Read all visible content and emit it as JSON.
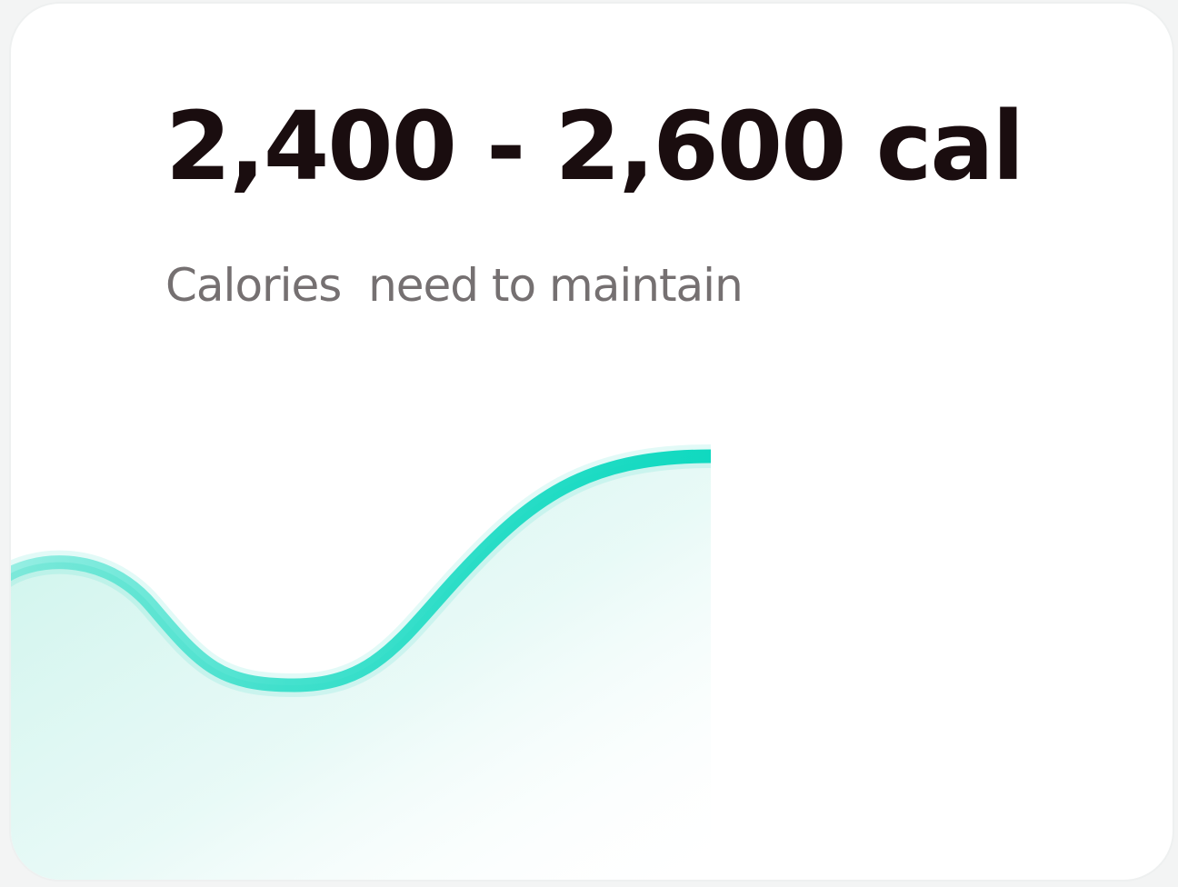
{
  "card": {
    "headline": "2,400 - 2,600 cal",
    "subtitle": "Calories  need to maintain"
  },
  "colors": {
    "headline": "#1a0d0f",
    "subtitle": "#757071",
    "accent": "#10d9c0"
  },
  "chart_data": {
    "type": "area",
    "axes_visible": false,
    "grid": true,
    "curve_shape": "wave: starts mid-high, dips to a low, rises to a high plateau"
  }
}
